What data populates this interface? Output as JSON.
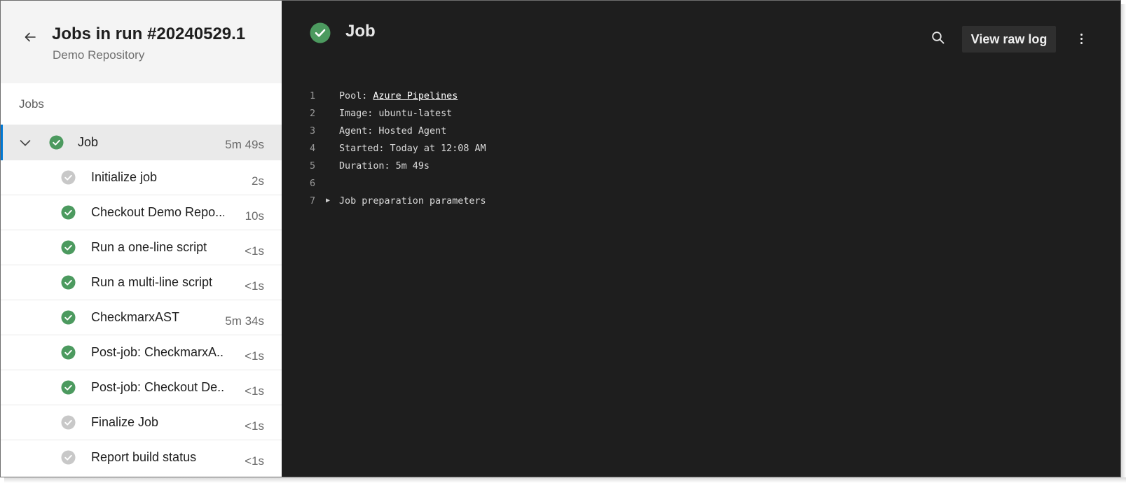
{
  "header": {
    "title": "Jobs in run #20240529.1",
    "subtitle": "Demo Repository"
  },
  "jobs_section": {
    "label": "Jobs"
  },
  "job": {
    "name": "Job",
    "duration": "5m 49s",
    "status": "succeeded"
  },
  "steps": [
    {
      "name": "Initialize job",
      "duration": "2s",
      "status": "skipped"
    },
    {
      "name": "Checkout Demo Repo...",
      "duration": "10s",
      "status": "succeeded"
    },
    {
      "name": "Run a one-line script",
      "duration": "<1s",
      "status": "succeeded"
    },
    {
      "name": "Run a multi-line script",
      "duration": "<1s",
      "status": "succeeded"
    },
    {
      "name": "CheckmarxAST",
      "duration": "5m 34s",
      "status": "succeeded"
    },
    {
      "name": "Post-job: CheckmarxA...",
      "duration": "<1s",
      "status": "succeeded"
    },
    {
      "name": "Post-job: Checkout De...",
      "duration": "<1s",
      "status": "succeeded"
    },
    {
      "name": "Finalize Job",
      "duration": "<1s",
      "status": "skipped"
    },
    {
      "name": "Report build status",
      "duration": "<1s",
      "status": "skipped"
    }
  ],
  "log_panel": {
    "title": "Job",
    "view_raw_label": "View raw log",
    "lines": [
      {
        "num": "1",
        "prefix": "Pool: ",
        "link": "Azure Pipelines"
      },
      {
        "num": "2",
        "text": "Image: ubuntu-latest"
      },
      {
        "num": "3",
        "text": "Agent: Hosted Agent"
      },
      {
        "num": "4",
        "text": "Started: Today at 12:08 AM"
      },
      {
        "num": "5",
        "text": "Duration: 5m 49s"
      },
      {
        "num": "6",
        "text": ""
      },
      {
        "num": "7",
        "text": "Job preparation parameters",
        "collapsible": true
      }
    ]
  },
  "icons": {
    "back": "arrow-left-icon",
    "expand": "chevron-down-icon",
    "success": "check-circle-icon",
    "skipped": "check-circle-gray-icon",
    "search": "search-icon",
    "more": "more-vertical-icon"
  },
  "colors": {
    "success": "#4c9a5f",
    "skipped": "#c8c8c8",
    "accent": "#0078d4",
    "log_bg": "#1e1e1e"
  }
}
